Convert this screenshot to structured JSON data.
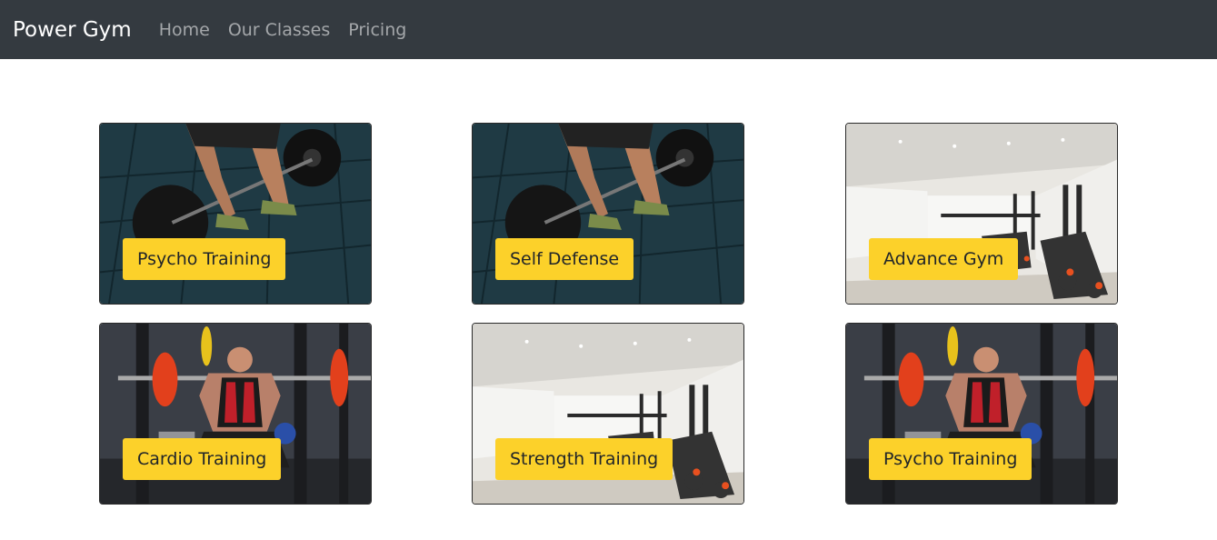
{
  "navbar": {
    "brand": "Power Gym",
    "links": [
      "Home",
      "Our Classes",
      "Pricing"
    ]
  },
  "classes": [
    {
      "title": "Psycho Training",
      "image": "deadlift-photo"
    },
    {
      "title": "Self Defense",
      "image": "deadlift-photo"
    },
    {
      "title": "Advance Gym",
      "image": "gym-interior-photo"
    },
    {
      "title": "Cardio Training",
      "image": "squat-rack-photo"
    },
    {
      "title": "Strength Training",
      "image": "gym-interior-photo"
    },
    {
      "title": "Psycho Training",
      "image": "squat-rack-photo"
    }
  ],
  "colors": {
    "navbar_bg": "#343a40",
    "label_bg": "#fcd12a"
  }
}
